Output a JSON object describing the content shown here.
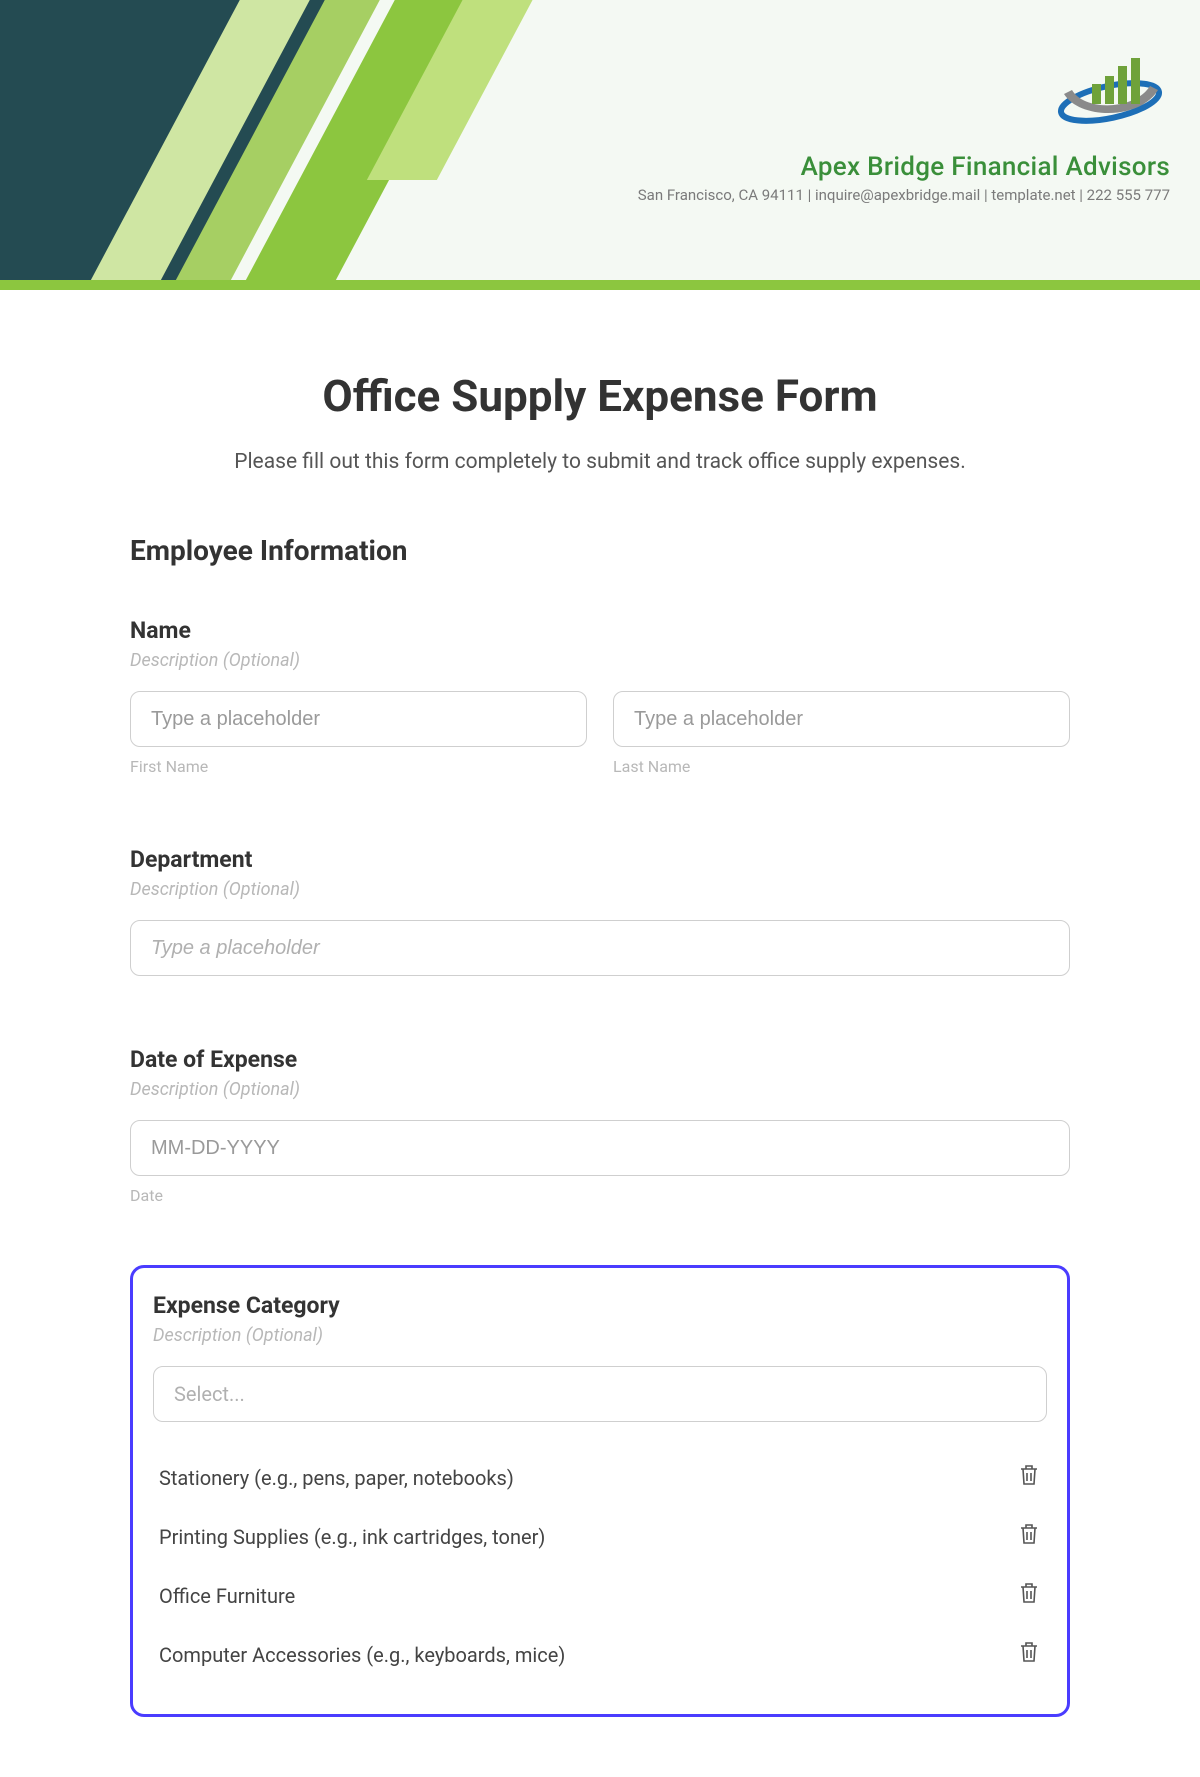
{
  "header": {
    "company_name": "Apex Bridge Financial Advisors",
    "meta_line": "San Francisco, CA 94111 | inquire@apexbridge.mail | template.net | 222 555 777"
  },
  "form": {
    "title": "Office Supply Expense Form",
    "intro": "Please fill out this form completely to submit and track office supply expenses.",
    "section_employee": "Employee Information",
    "desc_optional": "Description (Optional)",
    "name": {
      "label": "Name",
      "first_placeholder": "Type a placeholder",
      "first_sub": "First Name",
      "last_placeholder": "Type a placeholder",
      "last_sub": "Last Name"
    },
    "department": {
      "label": "Department",
      "placeholder": "Type a placeholder"
    },
    "date": {
      "label": "Date of Expense",
      "placeholder": "MM-DD-YYYY",
      "sub": "Date"
    },
    "category": {
      "label": "Expense Category",
      "select_placeholder": "Select...",
      "options": [
        "Stationery (e.g., pens, paper, notebooks)",
        "Printing Supplies (e.g., ink cartridges, toner)",
        "Office Furniture",
        "Computer Accessories (e.g., keyboards, mice)"
      ]
    }
  }
}
